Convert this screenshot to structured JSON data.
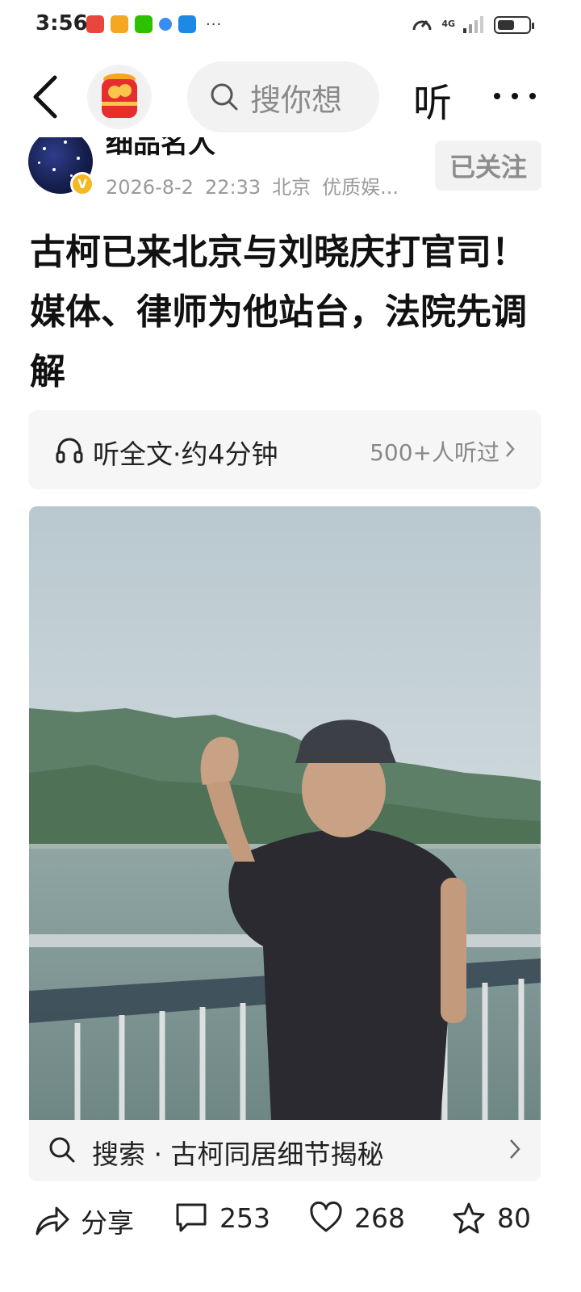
{
  "status_bar": {
    "time": "3:56",
    "network": "4G",
    "more": "···",
    "battery_level": 0.55
  },
  "nav": {
    "search_placeholder": "搜你想",
    "listen_label": "听"
  },
  "author": {
    "name": "细品名人",
    "date": "2026-8-2",
    "time": "22:33",
    "location": "北京",
    "tag": "优质娱...",
    "verified": "V",
    "follow_label": "已关注"
  },
  "article": {
    "title": "古柯已来北京与刘晓庆打官司！媒体、律师为他站台，法院先调解"
  },
  "listen_bar": {
    "label": "听全文·约4分钟",
    "count": "500+人听过"
  },
  "suggestion": {
    "label": "搜索 · 古柯同居细节揭秘"
  },
  "actions": {
    "share": "分享",
    "comments": "253",
    "likes": "268",
    "favorites": "80"
  }
}
